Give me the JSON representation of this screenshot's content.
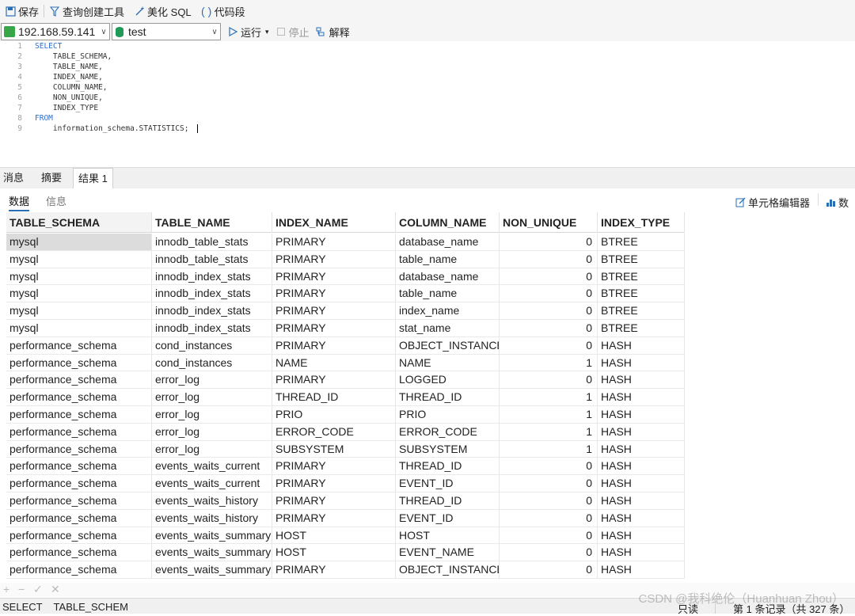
{
  "toolbar": {
    "save": "保存",
    "query_builder": "查询创建工具",
    "beautify": "美化 SQL",
    "code_snippet": "代码段"
  },
  "toolbar2": {
    "connection": "192.168.59.141",
    "database": "test",
    "run": "运行",
    "run_arrow": "▾",
    "stop": "停止",
    "explain": "解释"
  },
  "editor": {
    "line_numbers": [
      "1",
      "2",
      "3",
      "4",
      "5",
      "6",
      "7",
      "8",
      "9"
    ],
    "lines": [
      "SELECT",
      "    TABLE_SCHEMA,",
      "    TABLE_NAME,",
      "    INDEX_NAME,",
      "    COLUMN_NAME,",
      "    NON_UNIQUE,",
      "    INDEX_TYPE",
      "FROM",
      "    information_schema.STATISTICS;"
    ]
  },
  "result_tabs": [
    "消息",
    "摘要",
    "结果 1"
  ],
  "subtabs": {
    "data": "数据",
    "info": "信息",
    "cell_editor": "单元格编辑器",
    "data_trunc": "数"
  },
  "table": {
    "headers": [
      "TABLE_SCHEMA",
      "TABLE_NAME",
      "INDEX_NAME",
      "COLUMN_NAME",
      "NON_UNIQUE",
      "INDEX_TYPE"
    ],
    "rows": [
      [
        "mysql",
        "innodb_table_stats",
        "PRIMARY",
        "database_name",
        "0",
        "BTREE"
      ],
      [
        "mysql",
        "innodb_table_stats",
        "PRIMARY",
        "table_name",
        "0",
        "BTREE"
      ],
      [
        "mysql",
        "innodb_index_stats",
        "PRIMARY",
        "database_name",
        "0",
        "BTREE"
      ],
      [
        "mysql",
        "innodb_index_stats",
        "PRIMARY",
        "table_name",
        "0",
        "BTREE"
      ],
      [
        "mysql",
        "innodb_index_stats",
        "PRIMARY",
        "index_name",
        "0",
        "BTREE"
      ],
      [
        "mysql",
        "innodb_index_stats",
        "PRIMARY",
        "stat_name",
        "0",
        "BTREE"
      ],
      [
        "performance_schema",
        "cond_instances",
        "PRIMARY",
        "OBJECT_INSTANCE_",
        "0",
        "HASH"
      ],
      [
        "performance_schema",
        "cond_instances",
        "NAME",
        "NAME",
        "1",
        "HASH"
      ],
      [
        "performance_schema",
        "error_log",
        "PRIMARY",
        "LOGGED",
        "0",
        "HASH"
      ],
      [
        "performance_schema",
        "error_log",
        "THREAD_ID",
        "THREAD_ID",
        "1",
        "HASH"
      ],
      [
        "performance_schema",
        "error_log",
        "PRIO",
        "PRIO",
        "1",
        "HASH"
      ],
      [
        "performance_schema",
        "error_log",
        "ERROR_CODE",
        "ERROR_CODE",
        "1",
        "HASH"
      ],
      [
        "performance_schema",
        "error_log",
        "SUBSYSTEM",
        "SUBSYSTEM",
        "1",
        "HASH"
      ],
      [
        "performance_schema",
        "events_waits_current",
        "PRIMARY",
        "THREAD_ID",
        "0",
        "HASH"
      ],
      [
        "performance_schema",
        "events_waits_current",
        "PRIMARY",
        "EVENT_ID",
        "0",
        "HASH"
      ],
      [
        "performance_schema",
        "events_waits_history",
        "PRIMARY",
        "THREAD_ID",
        "0",
        "HASH"
      ],
      [
        "performance_schema",
        "events_waits_history",
        "PRIMARY",
        "EVENT_ID",
        "0",
        "HASH"
      ],
      [
        "performance_schema",
        "events_waits_summary",
        "HOST",
        "HOST",
        "0",
        "HASH"
      ],
      [
        "performance_schema",
        "events_waits_summary",
        "HOST",
        "EVENT_NAME",
        "0",
        "HASH"
      ],
      [
        "performance_schema",
        "events_waits_summary",
        "PRIMARY",
        "OBJECT_INSTANCE_",
        "0",
        "HASH"
      ]
    ]
  },
  "grid_controls": {
    "add": "+",
    "remove": "−",
    "apply": "✓",
    "cancel": "✕"
  },
  "status": {
    "sql": "SELECT    TABLE_SCHEM",
    "readonly": "只读",
    "records": "第 1 条记录（共 327 条）"
  },
  "watermark": "CSDN @我科绝伦（Huanhuan Zhou）"
}
